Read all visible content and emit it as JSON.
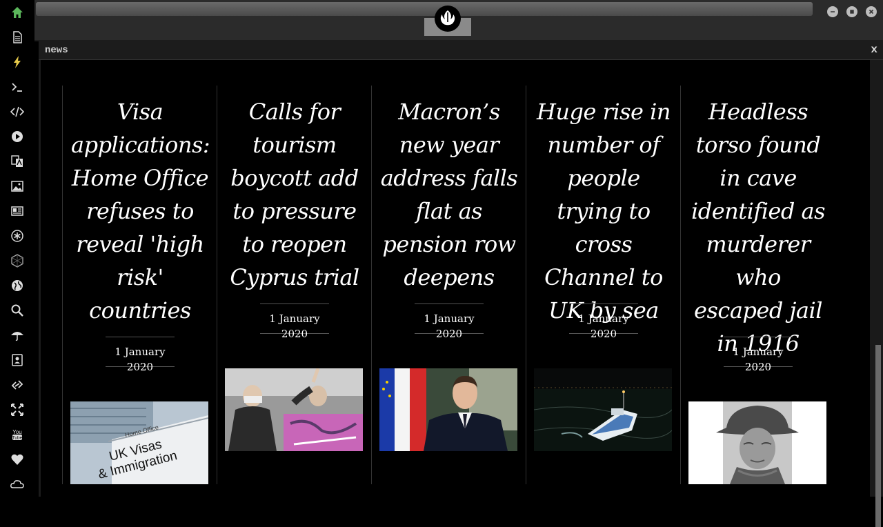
{
  "window": {
    "panel_title": "news",
    "close_label": "x"
  },
  "sidebar": {
    "items": [
      {
        "icon": "home-icon",
        "color": "#5cb85c"
      },
      {
        "icon": "document-icon"
      },
      {
        "icon": "bolt-icon",
        "color": "#e5c94a"
      },
      {
        "icon": "terminal-icon"
      },
      {
        "icon": "code-icon"
      },
      {
        "icon": "play-icon"
      },
      {
        "icon": "translate-icon"
      },
      {
        "icon": "image-icon"
      },
      {
        "icon": "newspaper-icon"
      },
      {
        "icon": "settings-asterisk-icon"
      },
      {
        "icon": "hexagon-icon"
      },
      {
        "icon": "globe-icon"
      },
      {
        "icon": "search-icon"
      },
      {
        "icon": "umbrella-icon"
      },
      {
        "icon": "contacts-icon"
      },
      {
        "icon": "link-icon"
      },
      {
        "icon": "expand-icon"
      },
      {
        "icon": "youtube-icon"
      },
      {
        "icon": "heart-icon"
      },
      {
        "icon": "cloud-icon"
      }
    ]
  },
  "articles": [
    {
      "title": "Visa applications: Home Office refuses to reveal 'high risk' countries",
      "date": "1 January 2020",
      "image": "uk-visas-immigration-sign"
    },
    {
      "title": "Calls for tourism boycott add to pressure to reopen Cyprus trial",
      "date": "1 January 2020",
      "image": "protest-crowd"
    },
    {
      "title": "Macron’s new year address falls flat as pension row deepens",
      "date": "1 January 2020",
      "image": "macron-address"
    },
    {
      "title": "Huge rise in number of people trying to cross Channel to UK by sea",
      "date": "1 January 2020",
      "image": "boat-at-night"
    },
    {
      "title": "Headless torso found in cave identified as murderer who escaped jail in 1916",
      "date": "1 January 2020",
      "image": "old-portrait"
    }
  ],
  "image_text": {
    "visa_sign_line1": "Home Office",
    "visa_sign_line2": "UK Visas",
    "visa_sign_line3": "& Immigration"
  }
}
